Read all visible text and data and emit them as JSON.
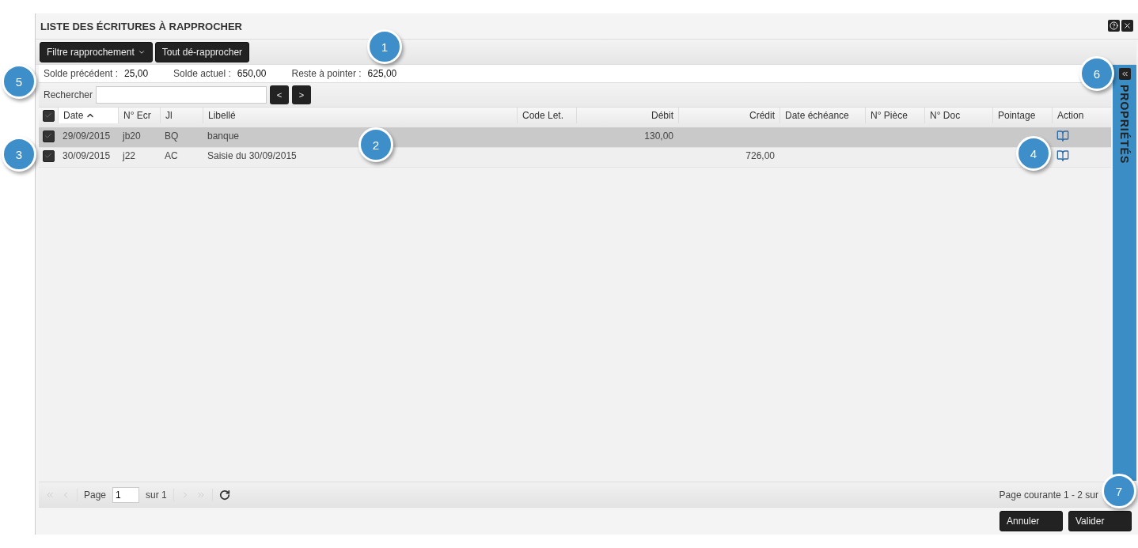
{
  "window": {
    "title": "LISTE DES ÉCRITURES À RAPPROCHER"
  },
  "toolbar": [
    {
      "kind": "dropdown",
      "label": "Filtre rapprochement"
    },
    {
      "kind": "button",
      "label": "Tout dé-rapprocher"
    }
  ],
  "balances": [
    {
      "label": "Solde précédent :",
      "value": "25,00"
    },
    {
      "label": "Solde actuel :",
      "value": "650,00"
    },
    {
      "label": "Reste à pointer :",
      "value": "625,00"
    }
  ],
  "search": {
    "label": "Rechercher",
    "prev": "<",
    "next": ">"
  },
  "table": {
    "select_all_checked": true,
    "columns": [
      {
        "label": "Date",
        "sorted": true
      },
      {
        "label": "N° Ecr",
        "sorted": false
      },
      {
        "label": "Jl",
        "sorted": false
      },
      {
        "label": "Libellé",
        "sorted": false
      },
      {
        "label": "Code Let.",
        "sorted": false
      },
      {
        "label": "Débit",
        "sorted": false
      },
      {
        "label": "Crédit",
        "sorted": false
      },
      {
        "label": "Date échéance",
        "sorted": false
      },
      {
        "label": "N° Pièce",
        "sorted": false
      },
      {
        "label": "N° Doc",
        "sorted": false
      },
      {
        "label": "Pointage",
        "sorted": false
      },
      {
        "label": "Action",
        "sorted": false
      }
    ],
    "rows": [
      {
        "selected": true,
        "checked": true,
        "cells": [
          "29/09/2015",
          "jb20",
          "BQ",
          "banque",
          "",
          "130,00",
          "",
          "",
          "",
          "",
          "",
          ""
        ]
      },
      {
        "selected": false,
        "checked": true,
        "cells": [
          "30/09/2015",
          "j22",
          "AC",
          "Saisie du 30/09/2015",
          "",
          "",
          "726,00",
          "",
          "",
          "",
          "",
          ""
        ]
      }
    ]
  },
  "pager": {
    "page_label": "Page",
    "page_value": "1",
    "of": "sur 1",
    "status": "Page courante 1 - 2 sur"
  },
  "side_panel": {
    "title": "PROPRIÉTÉS"
  },
  "footer_buttons": [
    "Annuler",
    "Valider"
  ],
  "callouts": [
    {
      "label": "1"
    },
    {
      "label": "2"
    },
    {
      "label": "3"
    },
    {
      "label": "4"
    },
    {
      "label": "5"
    },
    {
      "label": "6"
    },
    {
      "label": "7"
    }
  ]
}
